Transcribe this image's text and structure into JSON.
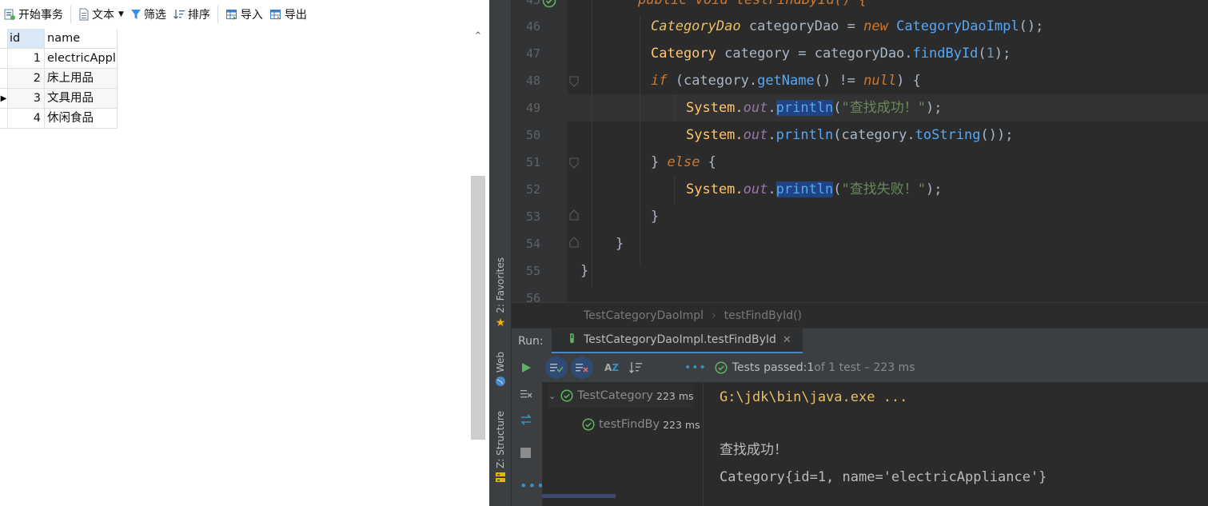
{
  "db_app": {
    "toolbar": {
      "begin_transaction": "开始事务",
      "text": "文本",
      "filter": "筛选",
      "sort": "排序",
      "import": "导入",
      "export": "导出"
    },
    "grid": {
      "columns": [
        "id",
        "name"
      ],
      "rows": [
        {
          "id": "1",
          "name": "electricAppl"
        },
        {
          "id": "2",
          "name": "床上用品"
        },
        {
          "id": "3",
          "name": "文具用品"
        },
        {
          "id": "4",
          "name": "休闲食品"
        }
      ],
      "current_row_index": 2
    }
  },
  "ide": {
    "side_tabs": {
      "favorites": "2: Favorites",
      "web": "Web",
      "structure": "Z: Structure"
    },
    "editor": {
      "first_line_partial": "public void testFindById() {",
      "line_numbers": [
        "46",
        "47",
        "48",
        "49",
        "50",
        "51",
        "52",
        "53",
        "54",
        "55",
        "56"
      ],
      "lines": {
        "l46_type": "CategoryDao",
        "l46_var": " categoryDao = ",
        "l46_new": "new",
        "l46_impl": " CategoryDaoImpl",
        "l46_tail": "();",
        "l47_type": "Category",
        "l47_var": " category = categoryDao.",
        "l47_meth": "findById",
        "l47_open": "(",
        "l47_num": "1",
        "l47_tail": ");",
        "l48_if": "if",
        "l48_a": " (category.",
        "l48_meth": "getName",
        "l48_b": "() != ",
        "l48_null": "null",
        "l48_c": ") {",
        "l49_sys": "System.",
        "l49_out": "out",
        "l49_dot": ".",
        "l49_meth": "println",
        "l49_open": "(",
        "l49_str": "\"查找成功！\"",
        "l49_tail": ");",
        "l50_sys": "System.",
        "l50_out": "out",
        "l50_dot": ".",
        "l50_meth": "println",
        "l50_a": "(category.",
        "l50_meth2": "toString",
        "l50_tail": "());",
        "l51_a": "} ",
        "l51_else": "else",
        "l51_b": " {",
        "l52_sys": "System.",
        "l52_out": "out",
        "l52_dot": ".",
        "l52_meth": "println",
        "l52_open": "(",
        "l52_str": "\"查找失败！\"",
        "l52_tail": ");",
        "l53": "}",
        "l54": "}",
        "l55": "}"
      }
    },
    "breadcrumb": [
      "TestCategoryDaoImpl",
      "testFindById()"
    ],
    "run": {
      "label": "Run:",
      "tab": "TestCategoryDaoImpl.testFindById",
      "status_prefix": "Tests passed: ",
      "status_count": "1",
      "status_suffix": " of 1 test – 223 ms",
      "tree": [
        {
          "name": "TestCategory",
          "time": "223 ms"
        },
        {
          "name": "testFindBy",
          "time": "223 ms"
        }
      ],
      "console": [
        "G:\\jdk\\bin\\java.exe ...",
        "",
        "查找成功！",
        "Category{id=1, name='electricAppliance'}"
      ]
    },
    "colors": {
      "background": "#2b2b2b",
      "keyword": "#cc7832",
      "string": "#6a8759",
      "method": "#56a8f5",
      "number": "#6897bb",
      "pass_green": "#5fb35f"
    }
  }
}
